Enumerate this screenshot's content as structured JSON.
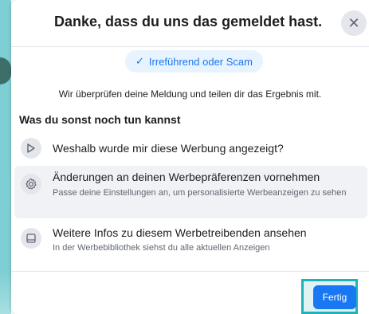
{
  "dialog": {
    "title": "Danke, dass du uns das gemeldet hast.",
    "close_icon": "close-icon",
    "chip": {
      "check": "✓",
      "label": "Irreführend oder Scam"
    },
    "info": "Wir überprüfen deine Meldung und teilen dir das Ergebnis mit.",
    "section_title": "Was du sonst noch tun kannst",
    "options": [
      {
        "icon": "play-triangle-icon",
        "title": "Weshalb wurde mir diese Werbung angezeigt?",
        "subtitle": ""
      },
      {
        "icon": "gear-icon",
        "title": "Änderungen an deinen Werbepräferenzen vornehmen",
        "subtitle": "Passe deine Einstellungen an, um personalisierte Werbeanzeigen zu sehen"
      },
      {
        "icon": "ad-library-icon",
        "title": "Weitere Infos zu diesem Werbetreibenden ansehen",
        "subtitle": "In der Werbebibliothek siehst du alle aktuellen Anzeigen"
      }
    ],
    "done_label": "Fertig"
  },
  "colors": {
    "accent": "#1877f2",
    "chip_bg": "#e7f3ff",
    "highlight_bg": "#f0f2f5",
    "frame": "#1fb3b8"
  }
}
